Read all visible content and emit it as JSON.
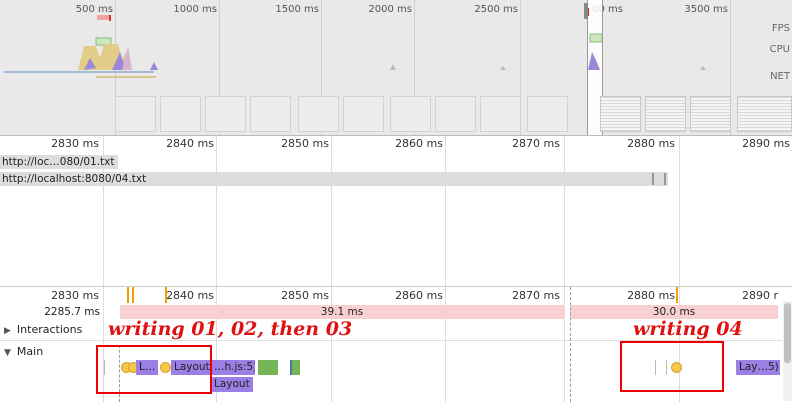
{
  "overview": {
    "ticks": [
      "500 ms",
      "1000 ms",
      "1500 ms",
      "2000 ms",
      "2500 ms",
      "00 ms",
      "3500 ms"
    ],
    "row_labels": {
      "fps": "FPS",
      "cpu": "CPU",
      "net": "NET"
    }
  },
  "detail": {
    "ticks": [
      "2830 ms",
      "2840 ms",
      "2850 ms",
      "2860 ms",
      "2870 ms",
      "2880 ms",
      "2890 ms"
    ],
    "network": [
      {
        "url": "http://loc…080/01.txt"
      },
      {
        "url": "http://localhost:8080/04.txt"
      }
    ]
  },
  "flame": {
    "ticks": [
      "2830 ms",
      "2840 ms",
      "2850 ms",
      "2860 ms",
      "2870 ms",
      "2880 ms",
      "2890 r"
    ],
    "frames_row": {
      "left_label": "2285.7 ms",
      "frame1": "39.1 ms",
      "frame2": "30.0 ms"
    },
    "tracks": {
      "interactions": "Interactions",
      "main": "Main"
    },
    "main_blocks": {
      "l_block": "L…",
      "layout_block": "Layout",
      "h_js_block": "…h.js:5)",
      "layout_sub": "Layout",
      "lay_right": "Lay…5)"
    }
  },
  "annotations": {
    "left": "writing 01, 02, then 03",
    "right": "writing 04"
  },
  "colors": {
    "annotation": "#e01010",
    "frame_bar": "#f8d0d0",
    "task": "#9b7fe4",
    "paint": "#74b558",
    "event": "#f3c84b"
  }
}
